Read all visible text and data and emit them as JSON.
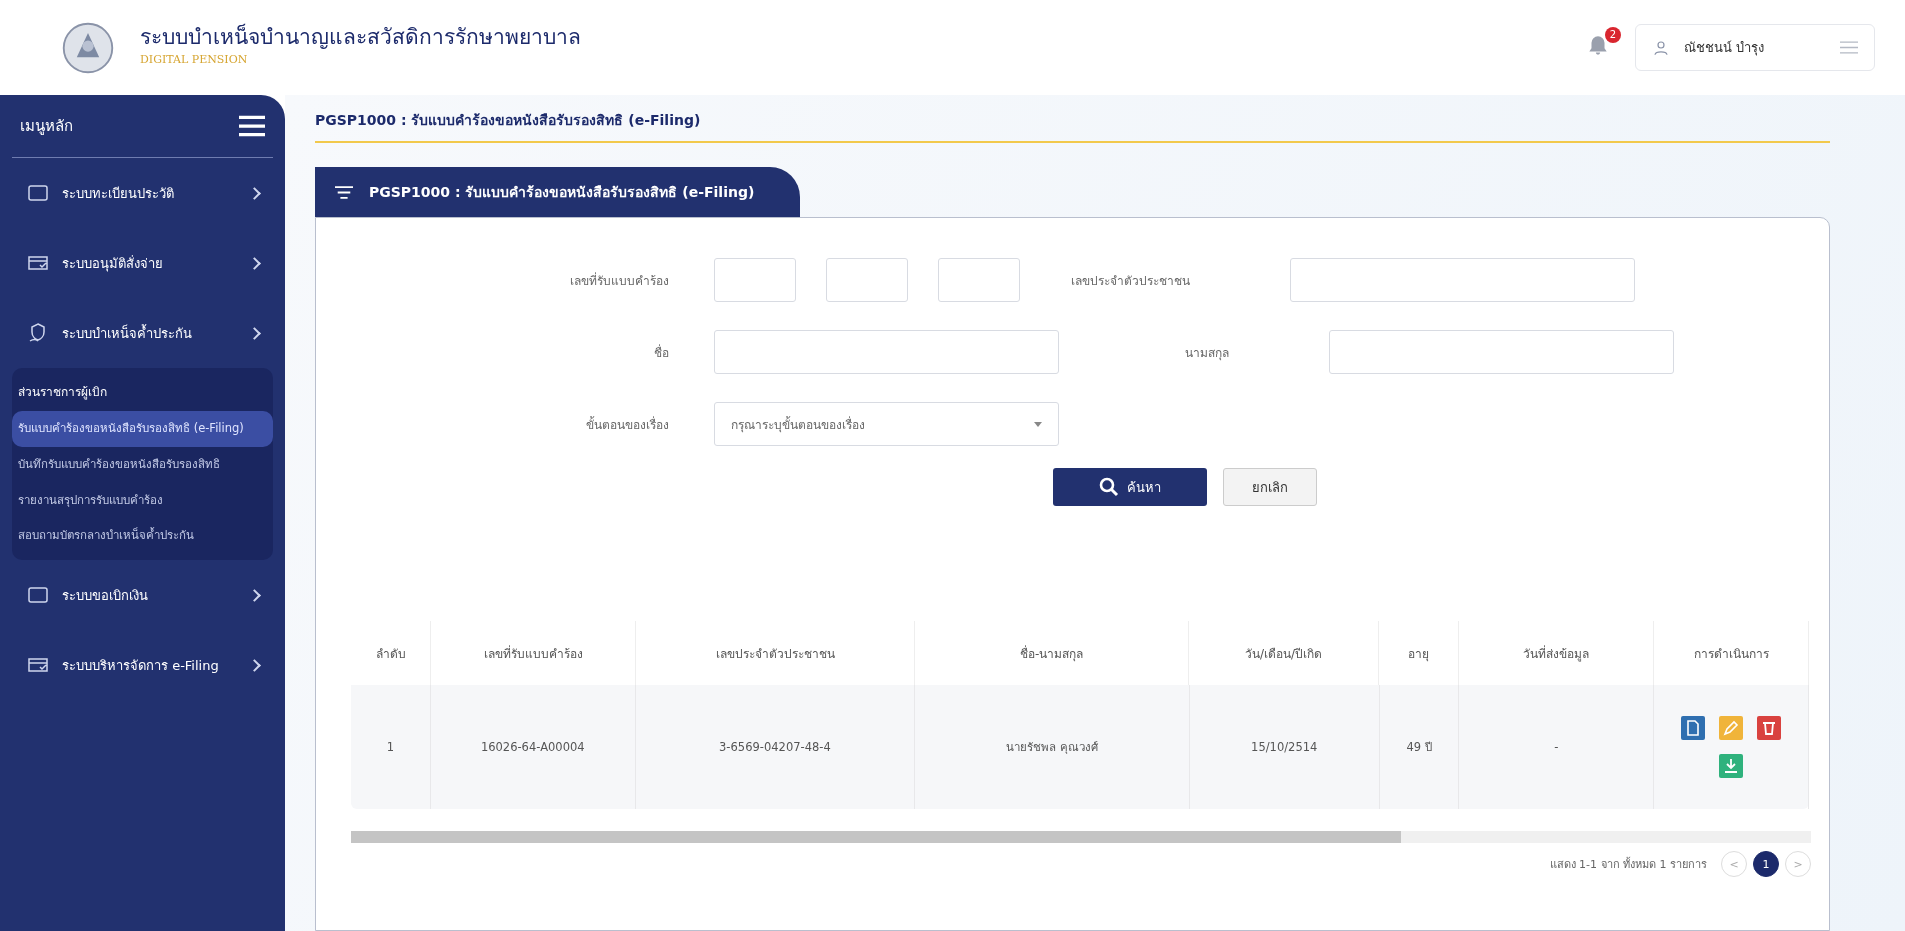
{
  "header": {
    "title": "ระบบบำเหน็จบำนาญและสวัสดิการรักษาพยาบาล",
    "subtitle": "DIGITAL PENSION",
    "notification_count": "2",
    "user_name": "ณัชชนน์ บำรุง"
  },
  "sidebar": {
    "title": "เมนูหลัก",
    "items": [
      {
        "label": "ระบบทะเบียนประวัติ"
      },
      {
        "label": "ระบบอนุมัติสั่งจ่าย"
      },
      {
        "label": "ระบบบำเหน็จค้ำประกัน",
        "expanded": true,
        "section_title": "ส่วนราชการผู้เบิก",
        "children": [
          {
            "label": "รับแบบคำร้องขอหนังสือรับรองสิทธิ (e-Filing)",
            "selected": true
          },
          {
            "label": "บันทึกรับแบบคำร้องขอหนังสือรับรองสิทธิ",
            "selected": false
          },
          {
            "label": "รายงานสรุปการรับแบบคำร้อง",
            "selected": false
          },
          {
            "label": "สอบถามบัตรกลางบำเหน็จค้ำประกัน",
            "selected": false
          }
        ]
      },
      {
        "label": "ระบบขอเบิกเงิน"
      },
      {
        "label": "ระบบบริหารจัดการ e-Filing"
      }
    ]
  },
  "breadcrumb": "PGSP1000 : รับแบบคำร้องขอหนังสือรับรองสิทธิ (e-Filing)",
  "card_tab": "PGSP1000 : รับแบบคำร้องขอหนังสือรับรองสิทธิ (e-Filing)",
  "form": {
    "request_number_label": "เลขที่รับแบบคำร้อง",
    "citizen_id_label": "เลขประจำตัวประชาชน",
    "first_name_label": "ชื่อ",
    "last_name_label": "นามสกุล",
    "status_label": "ขั้นตอนของเรื่อง",
    "status_placeholder": "กรุณาระบุขั้นตอนของเรื่อง",
    "search_button": "ค้นหา",
    "cancel_button": "ยกเลิก"
  },
  "table": {
    "columns": [
      "ลำดับ",
      "เลขที่รับแบบคำร้อง",
      "เลขประจำตัวประชาชน",
      "ชื่อ-นามสกุล",
      "วัน/เดือน/ปีเกิด",
      "อายุ",
      "วันที่ส่งข้อมูล",
      "การดำเนินการ"
    ],
    "rows": [
      [
        "1",
        "16026-64-A00004",
        "3-6569-04207-48-4",
        "นายรัชพล คุณวงศ์",
        "15/10/2514",
        "49 ปี",
        "-"
      ]
    ]
  },
  "pagination": {
    "summary": "แสดง 1-1 จาก ทั้งหมด 1 รายการ",
    "prev": "<",
    "next": ">",
    "pages": [
      {
        "label": "1",
        "selected": true
      }
    ]
  }
}
